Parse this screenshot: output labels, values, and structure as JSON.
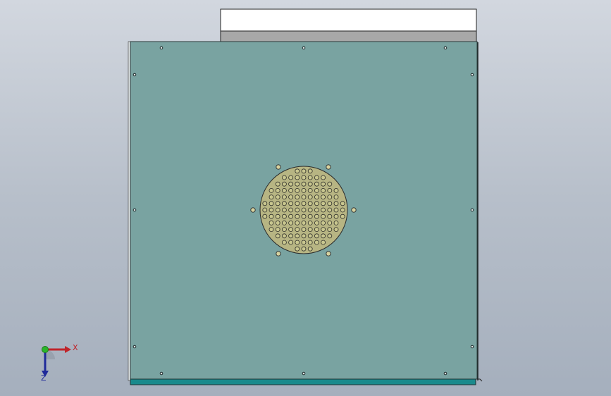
{
  "viewport": {
    "background_top": "#d2d7df",
    "background_bottom": "#a5afbd"
  },
  "model": {
    "panel_color": "#79a3a1",
    "panel_edge_color": "#2a3a3a",
    "top_lid_color": "#ffffff",
    "top_lid_band_color": "#a8a8a8",
    "base_strip_color": "#1a8a8c",
    "vent_fill_color": "#b7b583",
    "vent_grid_rows": 13,
    "vent_grid_cols": 13
  },
  "triad": {
    "x_label": "X",
    "z_label": "Z",
    "x_color": "#c0242a",
    "y_color": "#2bb52b",
    "z_color": "#1f2a9a"
  }
}
